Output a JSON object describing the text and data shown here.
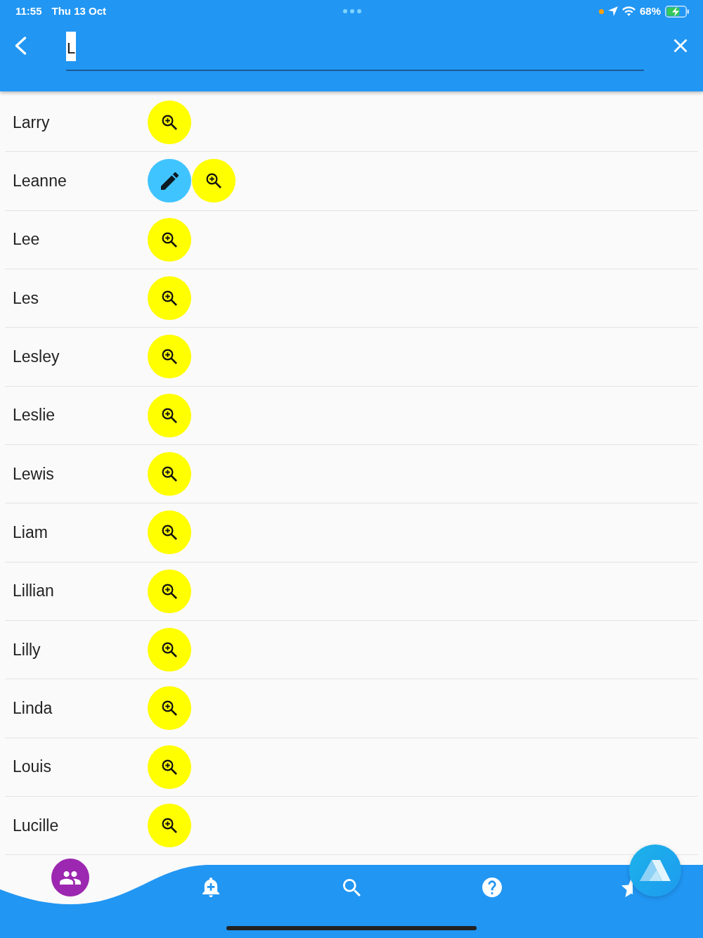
{
  "status_bar": {
    "time": "11:55",
    "date": "Thu 13 Oct",
    "battery": "68%"
  },
  "app_bar": {
    "search": {
      "value": "L",
      "text_selected": true
    }
  },
  "rows": [
    {
      "name": "Larry",
      "actions": [
        {
          "kind": "view"
        }
      ]
    },
    {
      "name": "Leanne",
      "actions": [
        {
          "kind": "edit"
        },
        {
          "kind": "view"
        }
      ]
    },
    {
      "name": "Lee",
      "actions": [
        {
          "kind": "view"
        }
      ]
    },
    {
      "name": "Les",
      "actions": [
        {
          "kind": "view"
        }
      ]
    },
    {
      "name": "Lesley",
      "actions": [
        {
          "kind": "view"
        }
      ]
    },
    {
      "name": "Leslie",
      "actions": [
        {
          "kind": "view"
        }
      ]
    },
    {
      "name": "Lewis",
      "actions": [
        {
          "kind": "view"
        }
      ]
    },
    {
      "name": "Liam",
      "actions": [
        {
          "kind": "view"
        }
      ]
    },
    {
      "name": "Lillian",
      "actions": [
        {
          "kind": "view"
        }
      ]
    },
    {
      "name": "Lilly",
      "actions": [
        {
          "kind": "view"
        }
      ]
    },
    {
      "name": "Linda",
      "actions": [
        {
          "kind": "view"
        }
      ]
    },
    {
      "name": "Louis",
      "actions": [
        {
          "kind": "view"
        }
      ]
    },
    {
      "name": "Lucille",
      "actions": [
        {
          "kind": "view"
        }
      ]
    }
  ],
  "bottom_nav": {
    "items": [
      {
        "selected": true
      },
      {
        "selected": false
      },
      {
        "selected": false
      },
      {
        "selected": false
      },
      {
        "selected": false
      }
    ]
  }
}
